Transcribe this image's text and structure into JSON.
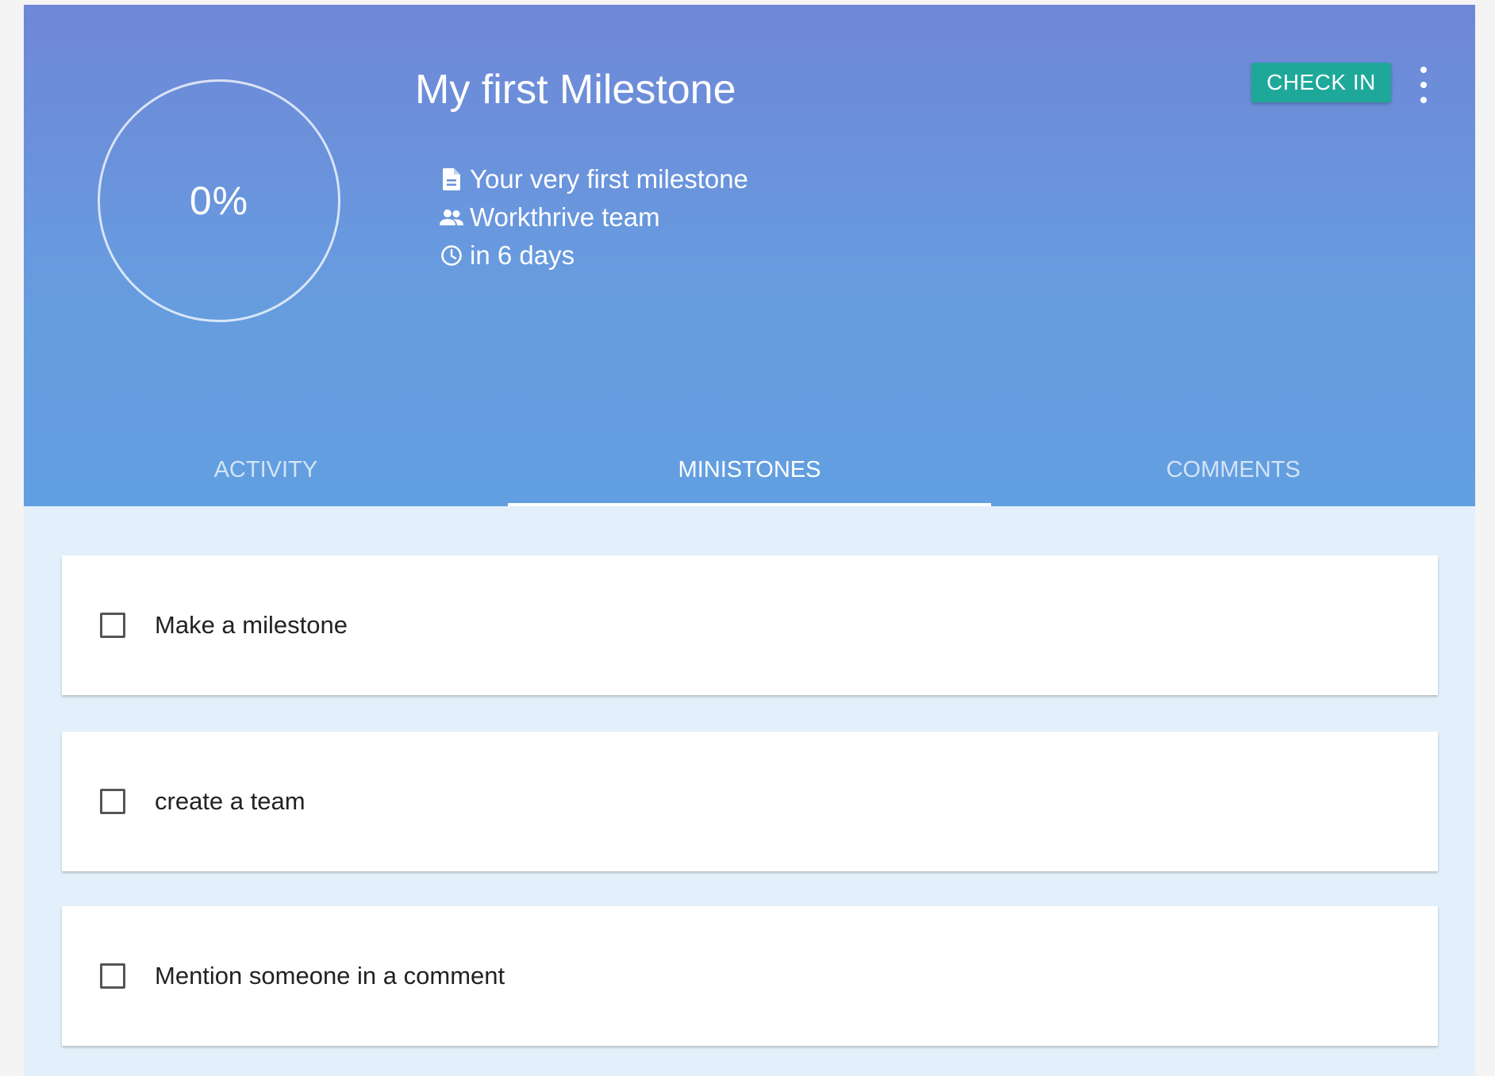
{
  "milestone": {
    "progress_text": "0%",
    "title": "My first Milestone",
    "description": "Your very first milestone",
    "team": "Workthrive team",
    "due": "in 6 days",
    "check_in_label": "CHECK IN"
  },
  "icons": {
    "description": "document-icon",
    "team": "people-icon",
    "due": "clock-icon",
    "more": "more-vertical-icon"
  },
  "colors": {
    "header_top": "#6f87d7",
    "header_bottom": "#629fe0",
    "check_in_button": "#1ea89a",
    "content_background": "#e3f0fb"
  },
  "tabs": [
    {
      "label": "ACTIVITY",
      "active": false
    },
    {
      "label": "MINISTONES",
      "active": true
    },
    {
      "label": "COMMENTS",
      "active": false
    }
  ],
  "ministones": [
    {
      "label": "Make a milestone",
      "checked": false
    },
    {
      "label": "create a team",
      "checked": false
    },
    {
      "label": "Mention someone in a comment",
      "checked": false
    }
  ]
}
